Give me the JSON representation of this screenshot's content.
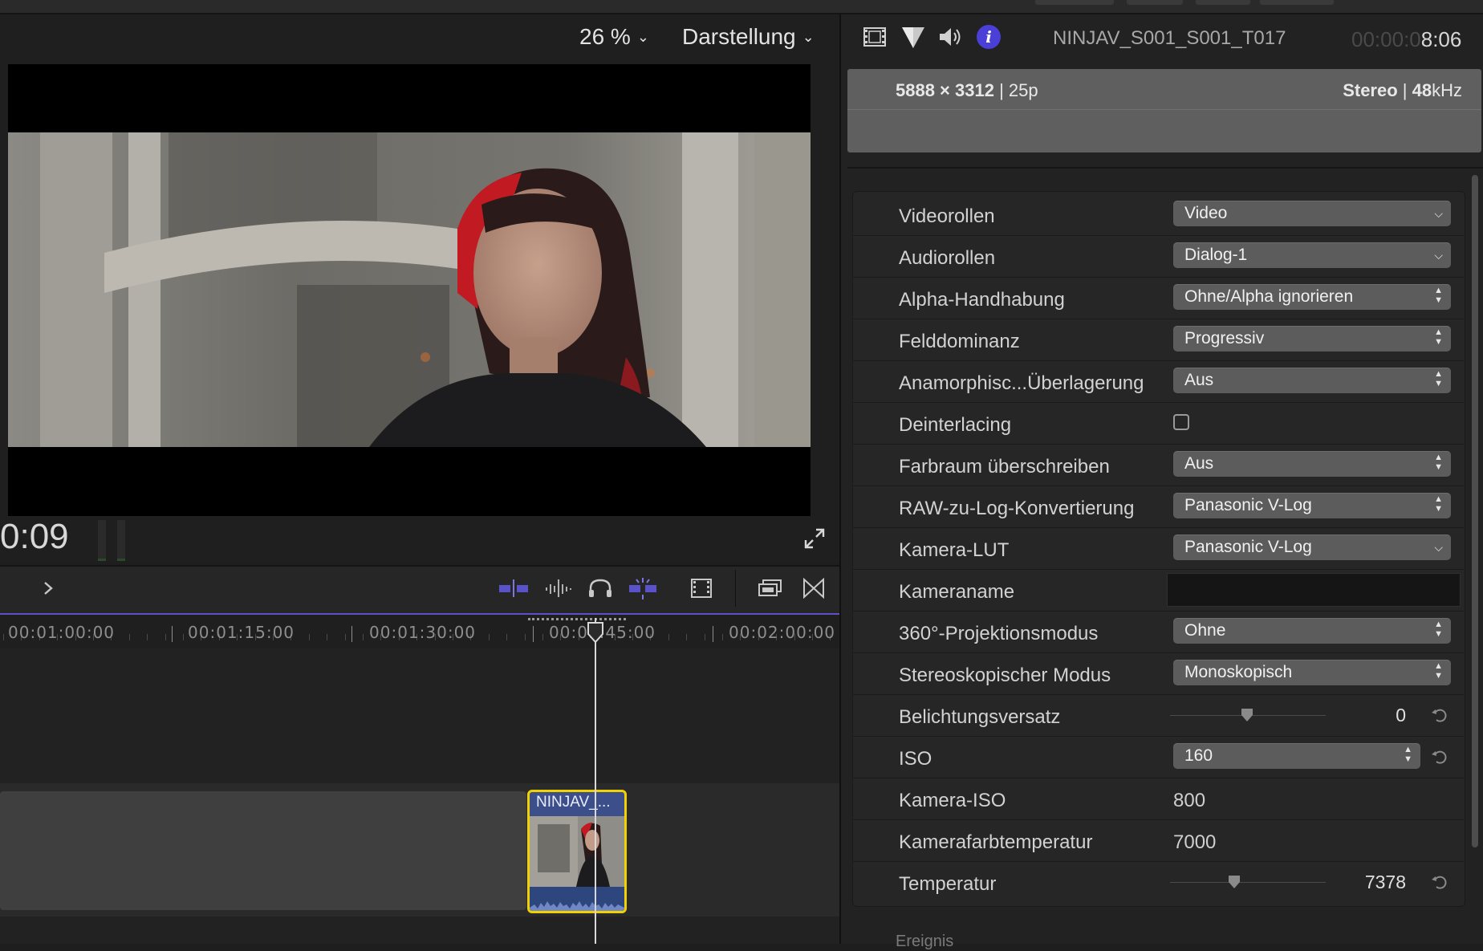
{
  "viewer": {
    "zoom": "26 %",
    "view_menu": "Darstellung",
    "timecode": "0:09"
  },
  "timeline": {
    "ruler_labels": [
      "00:01:00:00",
      "00:01:15:00",
      "00:01:30:00",
      "00:01:45:00",
      "00:02:00:00"
    ],
    "clip_title": "NINJAV_..."
  },
  "inspector": {
    "clip_name": "NINJAV_S001_S001_T017",
    "timecode_dim": "00:00:0",
    "timecode_bright": "8:06",
    "resolution": "5888 × 3312",
    "framerate": "25p",
    "audio_channels": "Stereo",
    "sample_rate_value": "48",
    "sample_rate_unit": "kHz",
    "properties": [
      {
        "label": "Videorollen",
        "value": "Video"
      },
      {
        "label": "Audiorollen",
        "value": "Dialog-1"
      },
      {
        "label": "Alpha-Handhabung",
        "value": "Ohne/Alpha ignorieren"
      },
      {
        "label": "Felddominanz",
        "value": "Progressiv"
      },
      {
        "label": "Anamorphisc...Überlagerung",
        "value": "Aus"
      },
      {
        "label": "Deinterlacing",
        "value": ""
      },
      {
        "label": "Farbraum überschreiben",
        "value": "Aus"
      },
      {
        "label": "RAW-zu-Log-Konvertierung",
        "value": "Panasonic V-Log"
      },
      {
        "label": "Kamera-LUT",
        "value": "Panasonic V-Log"
      },
      {
        "label": "Kameraname",
        "value": ""
      },
      {
        "label": "360°-Projektionsmodus",
        "value": "Ohne"
      },
      {
        "label": "Stereoskopischer Modus",
        "value": "Monoskopisch"
      },
      {
        "label": "Belichtungsversatz",
        "value": "0"
      },
      {
        "label": "ISO",
        "value": "160"
      },
      {
        "label": "Kamera-ISO",
        "value": "800"
      },
      {
        "label": "Kamerafarbtemperatur",
        "value": "7000"
      },
      {
        "label": "Temperatur",
        "value": "7378"
      }
    ],
    "section_next": "Ereignis"
  },
  "colors": {
    "accent": "#5a52c8",
    "clip_selection": "#f2d100",
    "info_icon": "#4a3fd6"
  },
  "icons": [
    "film-icon",
    "color-icon",
    "speaker-icon",
    "info-icon",
    "fullscreen-icon",
    "chevron-right-icon",
    "headphones-icon",
    "reset-icon"
  ]
}
